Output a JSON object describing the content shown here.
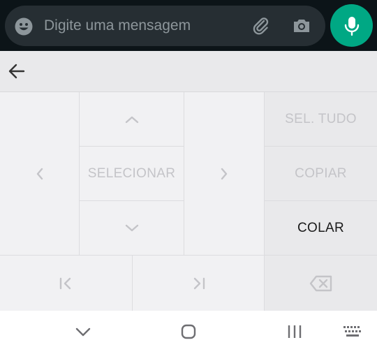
{
  "chat_input": {
    "placeholder": "Digite uma mensagem"
  },
  "keyboard": {
    "center_label": "SELECIONAR",
    "side_actions": [
      "SEL. TUDO",
      "COPIAR",
      "COLAR"
    ]
  },
  "icons": {
    "emoji": "emoji-icon",
    "attach": "paperclip-icon",
    "camera": "camera-icon",
    "mic": "mic-icon",
    "back": "arrow-left-icon",
    "up": "chevron-up-icon",
    "down": "chevron-down-icon",
    "left": "chevron-left-icon",
    "right": "chevron-right-icon",
    "home_line": "line-start-icon",
    "end_line": "line-end-icon",
    "backspace": "backspace-icon",
    "nav_back": "nav-down-chevron-icon",
    "nav_home": "nav-home-icon",
    "nav_recents": "nav-recents-icon",
    "nav_keyboard": "keyboard-icon"
  },
  "colors": {
    "mic_button": "#00a884",
    "topbar": "#0c1418",
    "input_pill": "#262e33",
    "keyboard_bg": "#f1f1f3",
    "disabled_text": "#c4c4c8",
    "active_text": "#1a1a1a"
  }
}
